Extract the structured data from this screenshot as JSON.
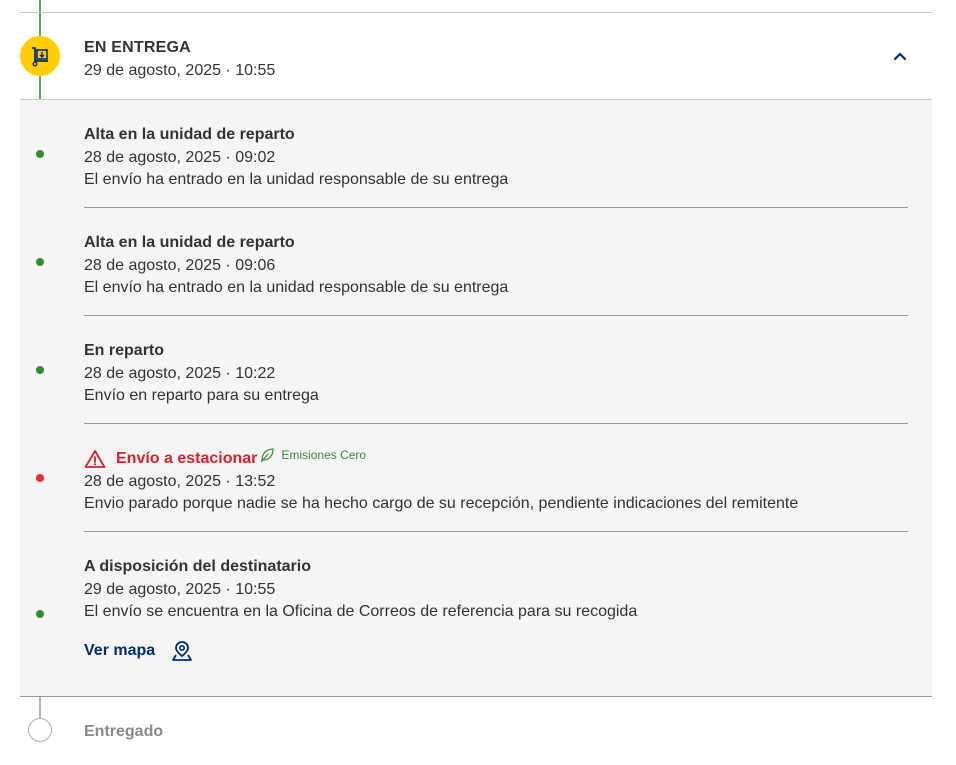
{
  "stage": {
    "title": "EN ENTREGA",
    "date": "29 de agosto, 2025 · 10:55",
    "icon": "delivery-cart-icon",
    "accent": "#ffcd00"
  },
  "events": [
    {
      "title": "Alta en la unidad de reparto",
      "date": "28 de agosto, 2025 · 09:02",
      "desc": "El envío ha entrado en la unidad responsable de su entrega"
    },
    {
      "title": "Alta en la unidad de reparto",
      "date": "28 de agosto, 2025 · 09:06",
      "desc": "El envío ha entrado en la unidad responsable de su entrega"
    },
    {
      "title": "En reparto",
      "date": "28 de agosto, 2025 · 10:22",
      "desc": "Envío en reparto para su entrega"
    },
    {
      "title": "Envío a estacionar",
      "eco_label": "Emisiones Cero",
      "date": "28 de agosto, 2025 · 13:52",
      "desc": "Envio parado porque nadie se ha hecho cargo de su recepción, pendiente indicaciones del remitente",
      "status": "warning",
      "color": "#d8232a"
    },
    {
      "title": "A disposición del destinatario",
      "date": "29 de agosto, 2025 · 10:55",
      "desc": "El envío se encuentra en la Oficina de Correos de referencia para su recogida",
      "link_label": "Ver mapa",
      "link_icon": "map-pin-icon"
    }
  ],
  "final_stage": {
    "label": "Entregado"
  },
  "colors": {
    "timeline_done": "#5aa55a",
    "timeline_pending": "#b0b0b0",
    "link": "#002e6d",
    "eco": "#3a8a3a"
  }
}
